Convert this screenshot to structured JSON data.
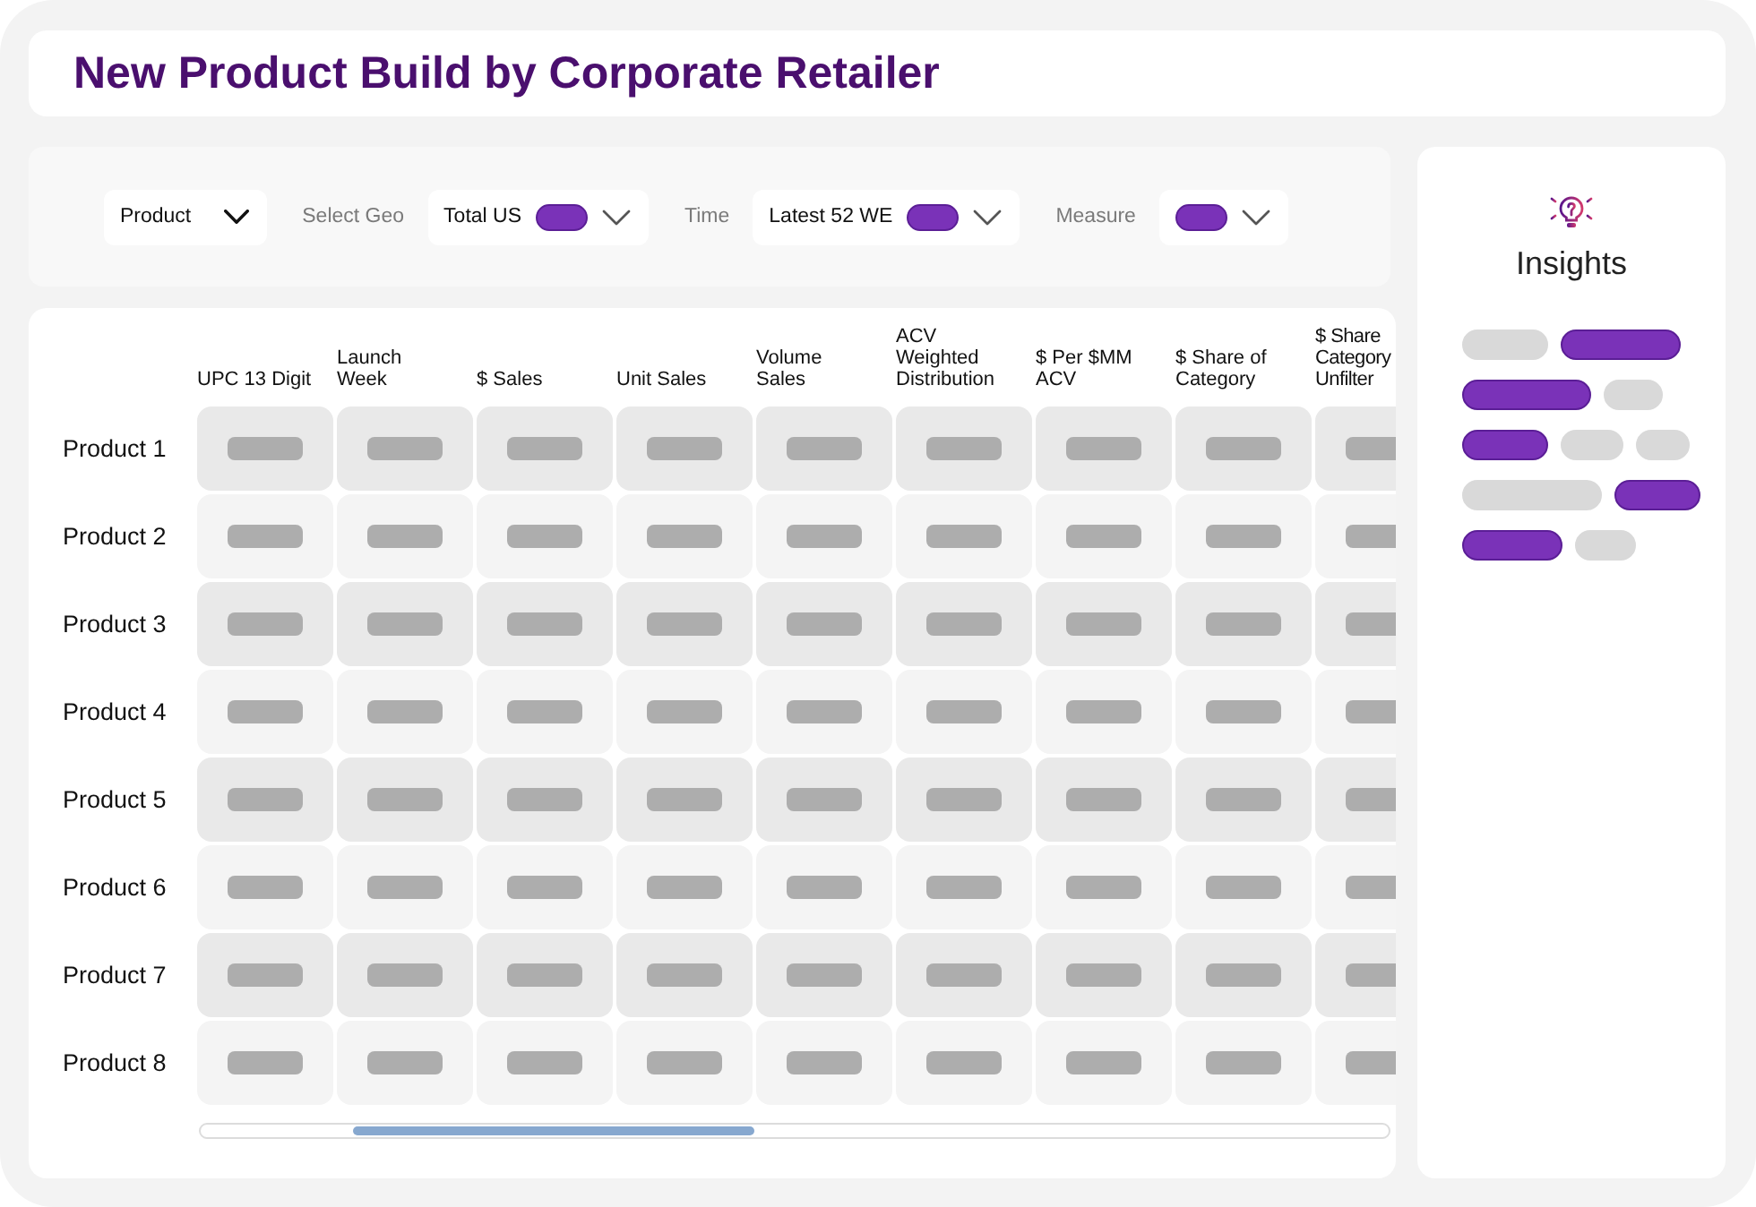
{
  "title": "New Product Build by Corporate Retailer",
  "filters": [
    {
      "kind": "dropdown",
      "value": "Product",
      "pill": false
    },
    {
      "kind": "label",
      "text": "Select Geo"
    },
    {
      "kind": "dropdown",
      "value": "Total US",
      "pill": true
    },
    {
      "kind": "label",
      "text": "Time"
    },
    {
      "kind": "dropdown",
      "value": "Latest 52 WE",
      "pill": true
    },
    {
      "kind": "label",
      "text": "Measure"
    },
    {
      "kind": "dropdown",
      "pill": true
    }
  ],
  "table": {
    "columns": [
      {
        "header": "UPC 13 Digit",
        "cut_off": false
      },
      {
        "header": "Launch\nWeek",
        "cut_off": false
      },
      {
        "header": "$ Sales",
        "cut_off": false
      },
      {
        "header": "Unit Sales",
        "cut_off": false
      },
      {
        "header": "Volume\nSales",
        "cut_off": false
      },
      {
        "header": "ACV\nWeighted\nDistribution",
        "cut_off": false
      },
      {
        "header": "$ Per $MM\nACV",
        "cut_off": false
      },
      {
        "header": "$ Share of\nCategory",
        "cut_off": false
      },
      {
        "header": "$ Share\nCategory\nUnfilter",
        "cut_off": true
      }
    ],
    "rows": [
      {
        "label": "Product 1"
      },
      {
        "label": "Product 2"
      },
      {
        "label": "Product 3"
      },
      {
        "label": "Product 4"
      },
      {
        "label": "Product 5"
      },
      {
        "label": "Product 6"
      },
      {
        "label": "Product 7"
      },
      {
        "label": "Product 8"
      }
    ]
  },
  "insights": {
    "title": "Insights",
    "lines": [
      [
        {
          "kind": "muted"
        },
        {
          "kind": "accent"
        }
      ],
      [
        {
          "kind": "accent"
        },
        {
          "kind": "muted"
        }
      ],
      [
        {
          "kind": "accent"
        },
        {
          "kind": "muted"
        },
        {
          "kind": "muted"
        }
      ],
      [
        {
          "kind": "muted"
        },
        {
          "kind": "accent"
        }
      ],
      [
        {
          "kind": "accent"
        },
        {
          "kind": "muted"
        }
      ]
    ]
  }
}
